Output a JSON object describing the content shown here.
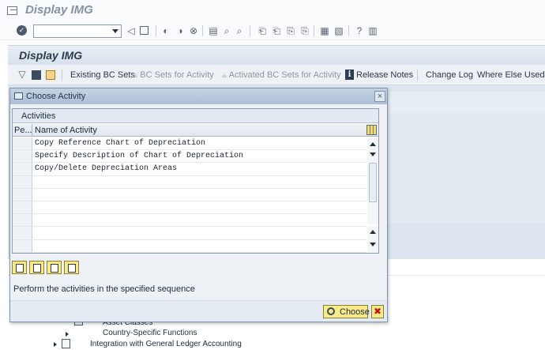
{
  "window": {
    "title": "Display IMG"
  },
  "system_toolbar": {
    "command_field_value": "",
    "icons": [
      "enter-icon",
      "back-icon",
      "save-icon",
      "back-nav-icon",
      "exit-icon",
      "cancel-icon",
      "print-icon",
      "find-icon",
      "find-next-icon",
      "first-page-icon",
      "previous-page-icon",
      "next-page-icon",
      "last-page-icon",
      "new-session-icon",
      "shortcut-icon",
      "help-icon",
      "layout-menu-icon"
    ]
  },
  "app": {
    "title": "Display IMG",
    "toolbar": {
      "existing_bc_sets": "Existing BC Sets",
      "bc_sets_for_activity": "BC Sets for Activity",
      "activated_bc_sets": "Activated BC Sets for Activity",
      "release_notes": "Release Notes",
      "change_log": "Change Log",
      "where_else_used": "Where Else Used"
    }
  },
  "tree": {
    "asset_classes": "Asset Classes",
    "country_specific": "Country-Specific Functions",
    "integration_gl": "Integration with General Ledger Accounting"
  },
  "dialog": {
    "title": "Choose Activity",
    "close": "×",
    "table": {
      "caption": "Activities",
      "col_pe": "Pe...",
      "col_name": "Name of Activity",
      "rows": [
        "Copy Reference Chart of Depreciation",
        "Specify Description of Chart of Depreciation",
        "Copy/Delete Depreciation Areas"
      ]
    },
    "hint": "Perform the activities in the specified sequence",
    "choose_label": "Choose"
  },
  "colors": {
    "dialog_title_bg": "#aebfd4",
    "button_yellow": "#f8e98a",
    "cancel_red": "#c11818"
  }
}
